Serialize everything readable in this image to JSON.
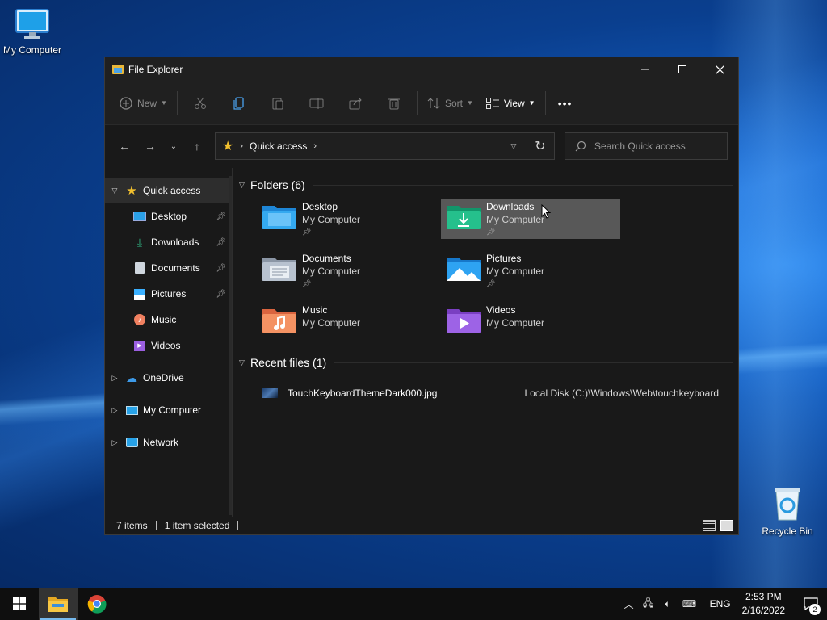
{
  "desktop": {
    "icons": [
      {
        "label": "My Computer"
      },
      {
        "label": "Recycle Bin"
      }
    ]
  },
  "window": {
    "title": "File Explorer"
  },
  "toolbar": {
    "new_label": "New",
    "sort_label": "Sort",
    "view_label": "View",
    "more_label": "•••"
  },
  "navbar": {
    "address_crumb": "Quick access",
    "search_placeholder": "Search Quick access"
  },
  "sidebar": {
    "items": [
      {
        "label": "Quick access"
      },
      {
        "label": "Desktop"
      },
      {
        "label": "Downloads"
      },
      {
        "label": "Documents"
      },
      {
        "label": "Pictures"
      },
      {
        "label": "Music"
      },
      {
        "label": "Videos"
      },
      {
        "label": "OneDrive"
      },
      {
        "label": "My Computer"
      },
      {
        "label": "Network"
      }
    ]
  },
  "content": {
    "folders_heading": "Folders (6)",
    "folders": [
      {
        "name": "Desktop",
        "location": "My Computer"
      },
      {
        "name": "Downloads",
        "location": "My Computer"
      },
      {
        "name": "Documents",
        "location": "My Computer"
      },
      {
        "name": "Pictures",
        "location": "My Computer"
      },
      {
        "name": "Music",
        "location": "My Computer"
      },
      {
        "name": "Videos",
        "location": "My Computer"
      }
    ],
    "recent_heading": "Recent files (1)",
    "recent_files": [
      {
        "name": "TouchKeyboardThemeDark000.jpg",
        "location": "Local Disk (C:)\\Windows\\Web\\touchkeyboard"
      }
    ]
  },
  "status": {
    "items": "7 items",
    "selected": "1 item selected"
  },
  "taskbar": {
    "language": "ENG",
    "time": "2:53 PM",
    "date": "2/16/2022",
    "notification_count": "2"
  },
  "colors": {
    "accent": "#76b9ed",
    "star": "#f2c02e",
    "window_bg": "#191919"
  }
}
